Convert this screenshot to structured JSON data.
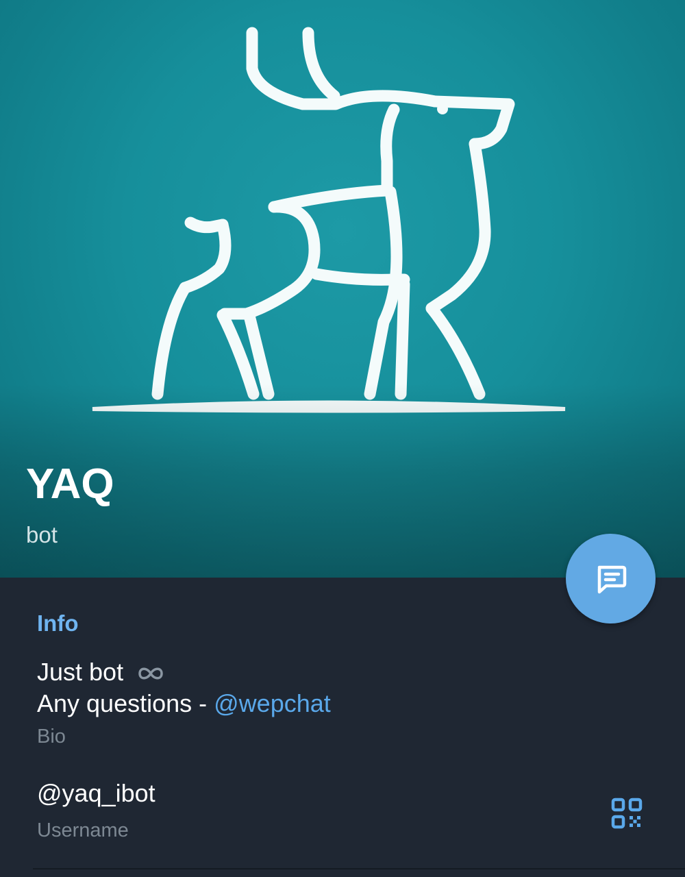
{
  "profile": {
    "name": "YAQ",
    "status": "bot",
    "avatar_icon": "deer-logo-icon",
    "header_color": "#168f9b"
  },
  "actions": {
    "message_button_icon": "message-icon",
    "message_button_color": "#62a9e4"
  },
  "info": {
    "section_title": "Info",
    "bio": {
      "line1": "Just bot",
      "line1_icon": "infinity-icon",
      "line2_prefix": "Any questions - ",
      "line2_mention": "@wepchat",
      "label": "Bio"
    },
    "username": {
      "value": "@yaq_ibot",
      "label": "Username",
      "action_icon": "qr-code-icon"
    }
  },
  "colors": {
    "background": "#1f2733",
    "accent": "#6fb4f0",
    "link": "#5aa8ea",
    "secondary_text": "#7d8893"
  }
}
